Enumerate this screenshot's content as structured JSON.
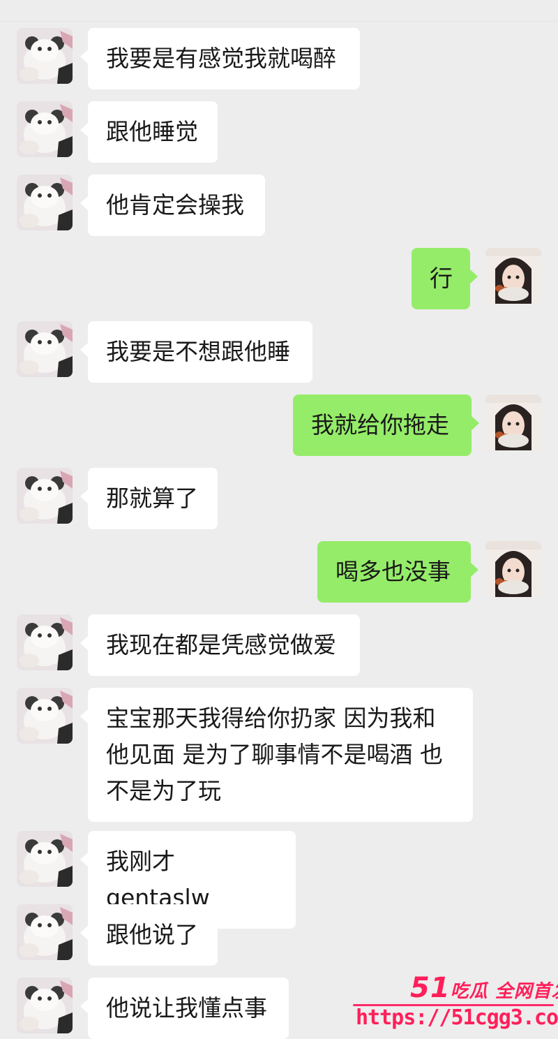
{
  "colors": {
    "background": "#ededed",
    "incoming_bubble": "#ffffff",
    "outgoing_bubble": "#95ec69",
    "watermark": "#ff1f5a"
  },
  "messages": [
    {
      "side": "left",
      "text": "我要是有感觉我就喝醉"
    },
    {
      "side": "left",
      "text": "跟他睡觉"
    },
    {
      "side": "left",
      "text": "他肯定会操我"
    },
    {
      "side": "right",
      "text": "行"
    },
    {
      "side": "left",
      "text": "我要是不想跟他睡"
    },
    {
      "side": "right",
      "text": "我就给你拖走"
    },
    {
      "side": "left",
      "text": "那就算了"
    },
    {
      "side": "right",
      "text": "喝多也没事"
    },
    {
      "side": "left",
      "text": "我现在都是凭感觉做爱"
    },
    {
      "side": "left",
      "text": "宝宝那天我得给你扔家 因为我和\n他见面 是为了聊事情不是喝酒 也\n不是为了玩"
    },
    {
      "side": "left",
      "text": "我刚才 gentaslw"
    },
    {
      "side": "left",
      "text": "跟他说了"
    },
    {
      "side": "left",
      "text": "他说让我懂点事"
    }
  ],
  "watermark": {
    "brand_num": "51",
    "brand_text": "吃瓜 全网首发",
    "url": "https://51cgg3.com"
  }
}
